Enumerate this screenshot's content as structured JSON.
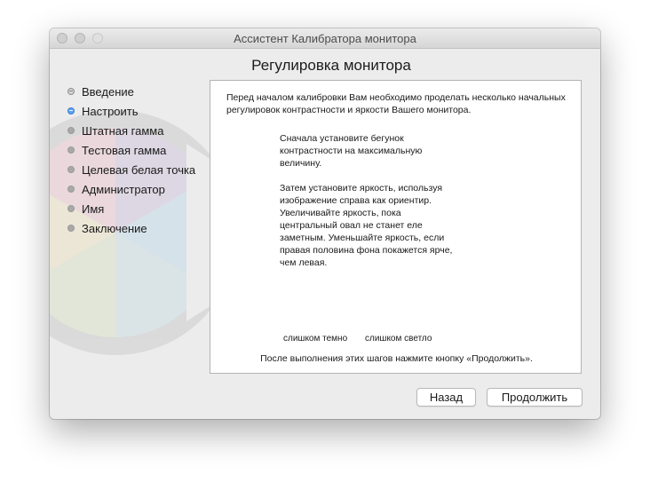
{
  "window": {
    "title": "Ассистент Калибратора монитора"
  },
  "page": {
    "title": "Регулировка монитора"
  },
  "steps": [
    {
      "label": "Введение",
      "state": "done"
    },
    {
      "label": "Настроить",
      "state": "current"
    },
    {
      "label": "Штатная гамма",
      "state": "pending"
    },
    {
      "label": "Тестовая гамма",
      "state": "pending"
    },
    {
      "label": "Целевая белая точка",
      "state": "pending"
    },
    {
      "label": "Администратор",
      "state": "pending"
    },
    {
      "label": "Имя",
      "state": "pending"
    },
    {
      "label": "Заключение",
      "state": "pending"
    }
  ],
  "panel": {
    "intro": "Перед началом калибровки Вам необходимо проделать несколько начальных регулировок контрастности и яркости Вашего монитора.",
    "step1": "Сначала установите бегунок контрастности на максимальную величину.",
    "step2": "Затем установите яркость, используя изображение справа как ориентир. Увеличивайте яркость, пока центральный овал не станет еле заметным. Уменьшайте яркость, если правая половина фона покажется ярче, чем левая.",
    "too_dark": "слишком темно",
    "too_bright": "слишком светло",
    "hint": "После выполнения этих шагов нажмите кнопку «Продолжить»."
  },
  "buttons": {
    "back": "Назад",
    "continue": "Продолжить"
  },
  "colors": {
    "current_step": "#5aa2f2",
    "window_bg": "#ececec"
  }
}
